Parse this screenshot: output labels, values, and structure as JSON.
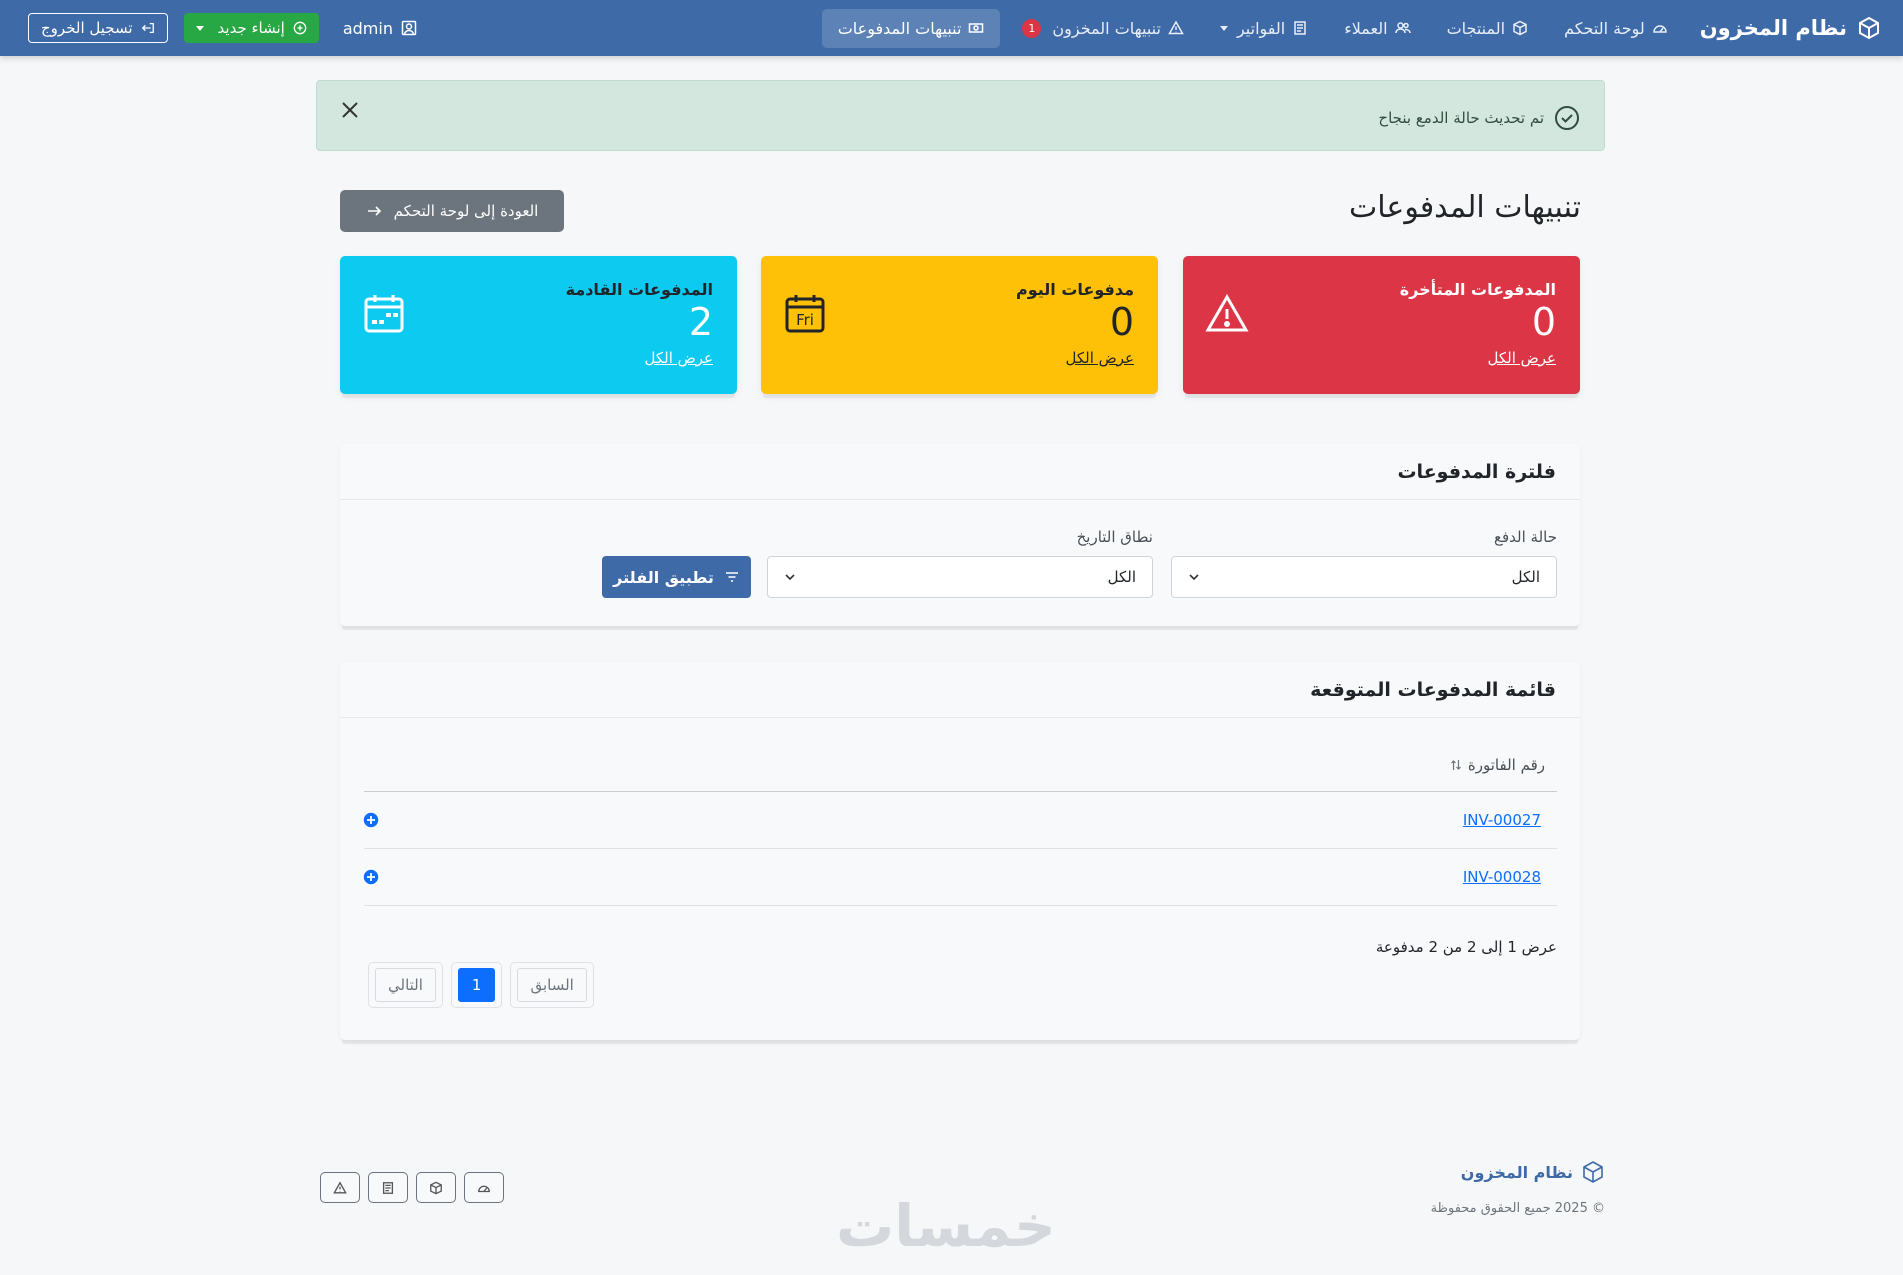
{
  "nav": {
    "brand": "نظام المخزون",
    "items": [
      {
        "label": "لوحة التحكم"
      },
      {
        "label": "المنتجات"
      },
      {
        "label": "العملاء"
      },
      {
        "label": "الفواتير"
      },
      {
        "label": "تنبيهات المخزون",
        "badge": "1"
      },
      {
        "label": "تنبيهات المدفوعات"
      }
    ],
    "user": "admin",
    "create_label": "إنشاء جديد",
    "logout_label": "تسجيل الخروج"
  },
  "alert": {
    "message": "تم تحديث حالة الدمع بنجاح"
  },
  "page": {
    "title": "تنبيهات المدفوعات",
    "back_label": "العودة إلى لوحة التحكم"
  },
  "cards": [
    {
      "title": "المدفوعات المتأخرة",
      "value": "0",
      "link": "عرض الكل",
      "icon": "warning-icon",
      "color": "#dc3545"
    },
    {
      "title": "مدفوعات اليوم",
      "value": "0",
      "link": "عرض الكل",
      "icon": "calendar-today-icon",
      "icon_text": "Fri",
      "color": "#ffc107"
    },
    {
      "title": "المدفوعات القادمة",
      "value": "2",
      "link": "عرض الكل",
      "icon": "calendar-week-icon",
      "color": "#0dcaf0"
    }
  ],
  "filter": {
    "title": "فلترة المدفوعات",
    "status_label": "حالة الدفع",
    "status_value": "الكل",
    "date_label": "نطاق التاريخ",
    "date_value": "الكل",
    "apply_label": "تطبيق الفلتر"
  },
  "list": {
    "title": "قائمة المدفوعات المتوقعة",
    "column": "رقم الفاتورة",
    "rows": [
      {
        "invoice": "INV-00027"
      },
      {
        "invoice": "INV-00028"
      }
    ],
    "summary": "عرض 1 إلى 2 من 2 مدفوعة",
    "prev_label": "السابق",
    "current_page": "1",
    "next_label": "التالي"
  },
  "footer": {
    "brand": "نظام المخزون",
    "copyright": "© 2025 جميع الحقوق محفوظة",
    "watermark": "خمسات"
  },
  "colors": {
    "navbar": "#3e6aa8",
    "success": "#28a745",
    "primary": "#0d6efd"
  }
}
